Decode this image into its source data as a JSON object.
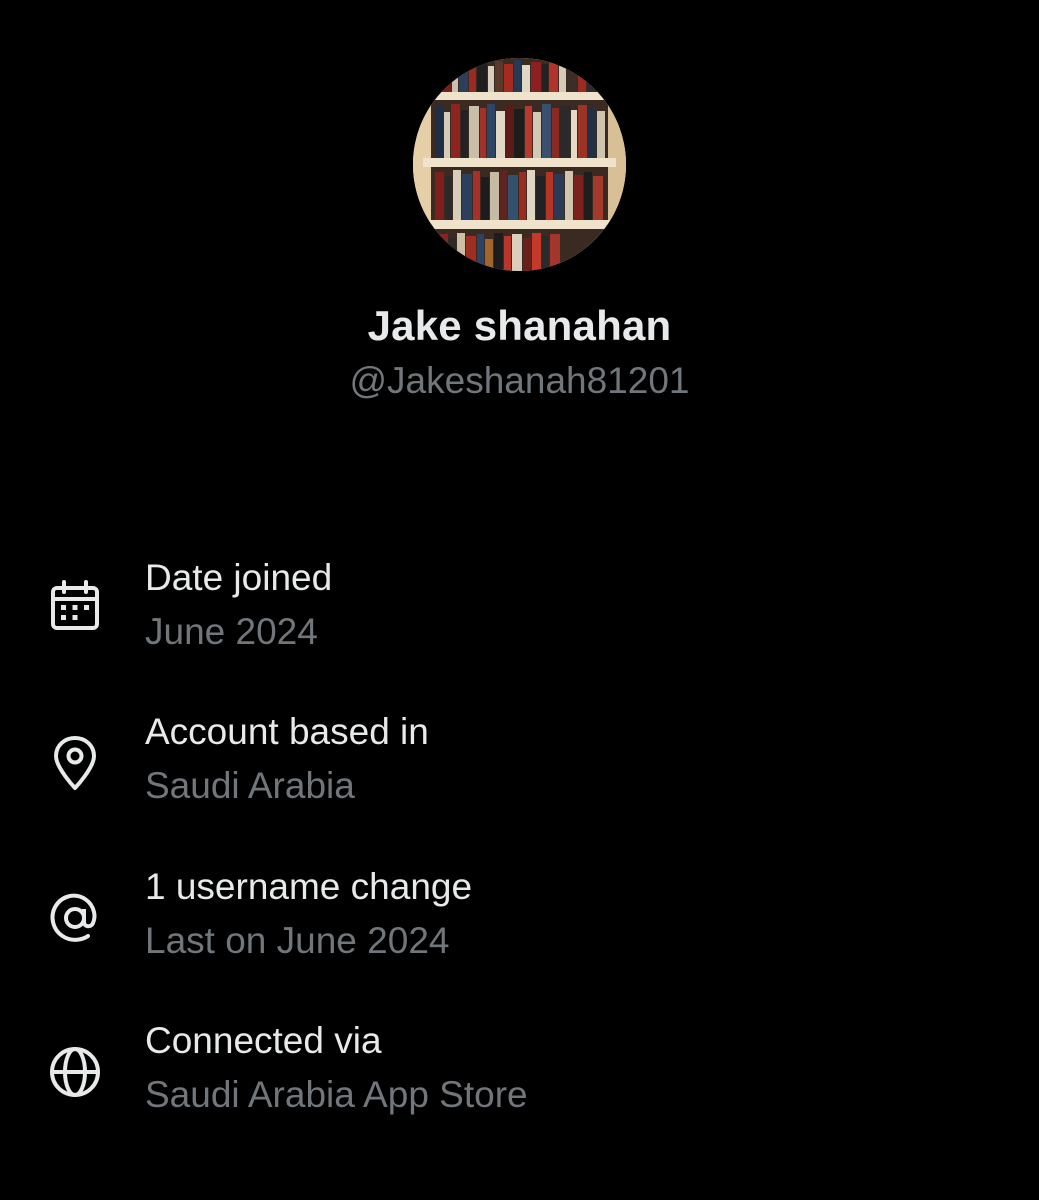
{
  "profile": {
    "display_name": "Jake shanahan",
    "handle": "@Jakeshanah81201",
    "avatar_description": "bookshelf-photo"
  },
  "about": {
    "items": [
      {
        "icon": "calendar-icon",
        "label": "Date joined",
        "value": "June 2024"
      },
      {
        "icon": "location-pin-icon",
        "label": "Account based in",
        "value": "Saudi Arabia"
      },
      {
        "icon": "at-sign-icon",
        "label": "1 username change",
        "value": "Last on June 2024"
      },
      {
        "icon": "globe-icon",
        "label": "Connected via",
        "value": "Saudi Arabia App Store"
      }
    ]
  },
  "colors": {
    "background": "#000000",
    "primary_text": "#e7e9ea",
    "secondary_text": "#71767b"
  }
}
